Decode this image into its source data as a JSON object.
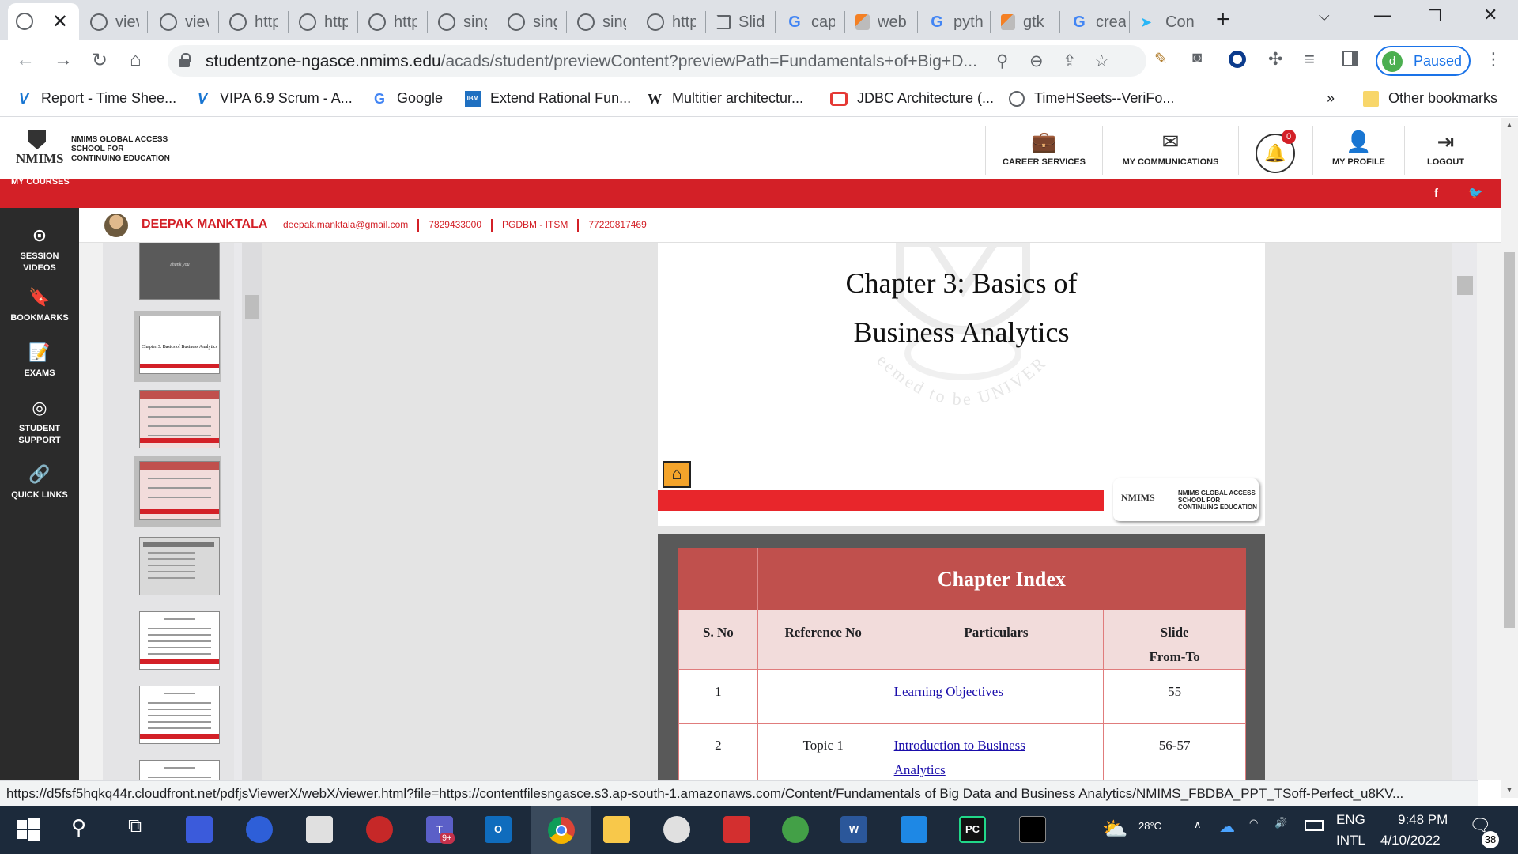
{
  "browser": {
    "tabs": [
      {
        "label": "",
        "active": true
      },
      {
        "label": "viev"
      },
      {
        "label": "viev"
      },
      {
        "label": "http"
      },
      {
        "label": "http"
      },
      {
        "label": "http"
      },
      {
        "label": "sing"
      },
      {
        "label": "sing"
      },
      {
        "label": "sing"
      },
      {
        "label": "http"
      },
      {
        "label": "Slid"
      },
      {
        "label": "cap"
      },
      {
        "label": "web"
      },
      {
        "label": "pyth"
      },
      {
        "label": "gtk"
      },
      {
        "label": "crea"
      },
      {
        "label": "Con"
      }
    ],
    "url_domain": "studentzone-ngasce.nmims.edu",
    "url_path": "/acads/student/previewContent?previewPath=Fundamentals+of+Big+D...",
    "profile_label": "Paused",
    "profile_initial": "d",
    "bookmarks": [
      "Report - Time Shee...",
      "VIPA 6.9 Scrum - A...",
      "Google",
      "Extend Rational Fun...",
      "Multitier architectur...",
      "JDBC Architecture (...",
      "TimeHSeets--VeriFo..."
    ],
    "other_bookmarks": "Other bookmarks",
    "more_bookmarks": "»",
    "status_url": "https://d5fsf5hqkq44r.cloudfront.net/pdfjsViewerX/webX/viewer.html?file=https://contentfilesngasce.s3.ap-south-1.amazonaws.com/Content/Fundamentals of Big Data and Business Analytics/NMIMS_FBDBA_PPT_TSoff-Perfect_u8KV..."
  },
  "site": {
    "logo_word": "NMIMS",
    "logo_text": [
      "NMIMS GLOBAL ACCESS",
      "SCHOOL FOR",
      "CONTINUING EDUCATION"
    ],
    "header_items": [
      {
        "label": "CAREER SERVICES",
        "icon": "briefcase-icon"
      },
      {
        "label": "MY COMMUNICATIONS",
        "icon": "envelope-icon"
      },
      {
        "label": "MY PROFILE",
        "icon": "user-icon"
      },
      {
        "label": "LOGOUT",
        "icon": "logout-icon"
      }
    ],
    "notification_count": "0",
    "my_courses": "MY COURSES",
    "social": [
      "f",
      "t"
    ],
    "sidebar": [
      {
        "label": "SESSION VIDEOS",
        "icon": "play-icon"
      },
      {
        "label": "BOOKMARKS",
        "icon": "bookmark-icon"
      },
      {
        "label": "EXAMS",
        "icon": "exam-icon"
      },
      {
        "label": "STUDENT SUPPORT",
        "icon": "support-icon"
      },
      {
        "label": "QUICK LINKS",
        "icon": "link-icon"
      }
    ],
    "user": {
      "name": "DEEPAK MANKTALA",
      "email": "deepak.manktala@gmail.com",
      "phone": "7829433000",
      "program": "PGDBM - ITSM",
      "id": "77220817469"
    }
  },
  "viewer": {
    "thumb_title": "Chapter 3: Basics of Business Analytics",
    "thumb_thankyou": "Thank you",
    "slide_title_line1": "Chapter 3: Basics of",
    "slide_title_line2": "Business Analytics",
    "watermark_text": "eemed to be UNIVERSITY",
    "slide_logo_word": "NMIMS",
    "slide_logo_text": [
      "NMIMS GLOBAL ACCESS",
      "SCHOOL FOR",
      "CONTINUING EDUCATION"
    ],
    "index": {
      "title": "Chapter Index",
      "headers": [
        "S. No",
        "Reference No",
        "Particulars",
        "Slide",
        "From-To"
      ],
      "rows": [
        {
          "sno": "1",
          "ref": "",
          "particulars": "Learning Objectives",
          "slides": "55"
        },
        {
          "sno": "2",
          "ref": "Topic 1",
          "particulars_line1": "Introduction to Business",
          "particulars_line2": "Analytics",
          "slides": "56-57"
        }
      ]
    }
  },
  "taskbar": {
    "temperature": "28°C",
    "lang1": "ENG",
    "lang2": "INTL",
    "time": "9:48 PM",
    "date": "4/10/2022",
    "notifications": "38",
    "teams_badge": "9+"
  }
}
